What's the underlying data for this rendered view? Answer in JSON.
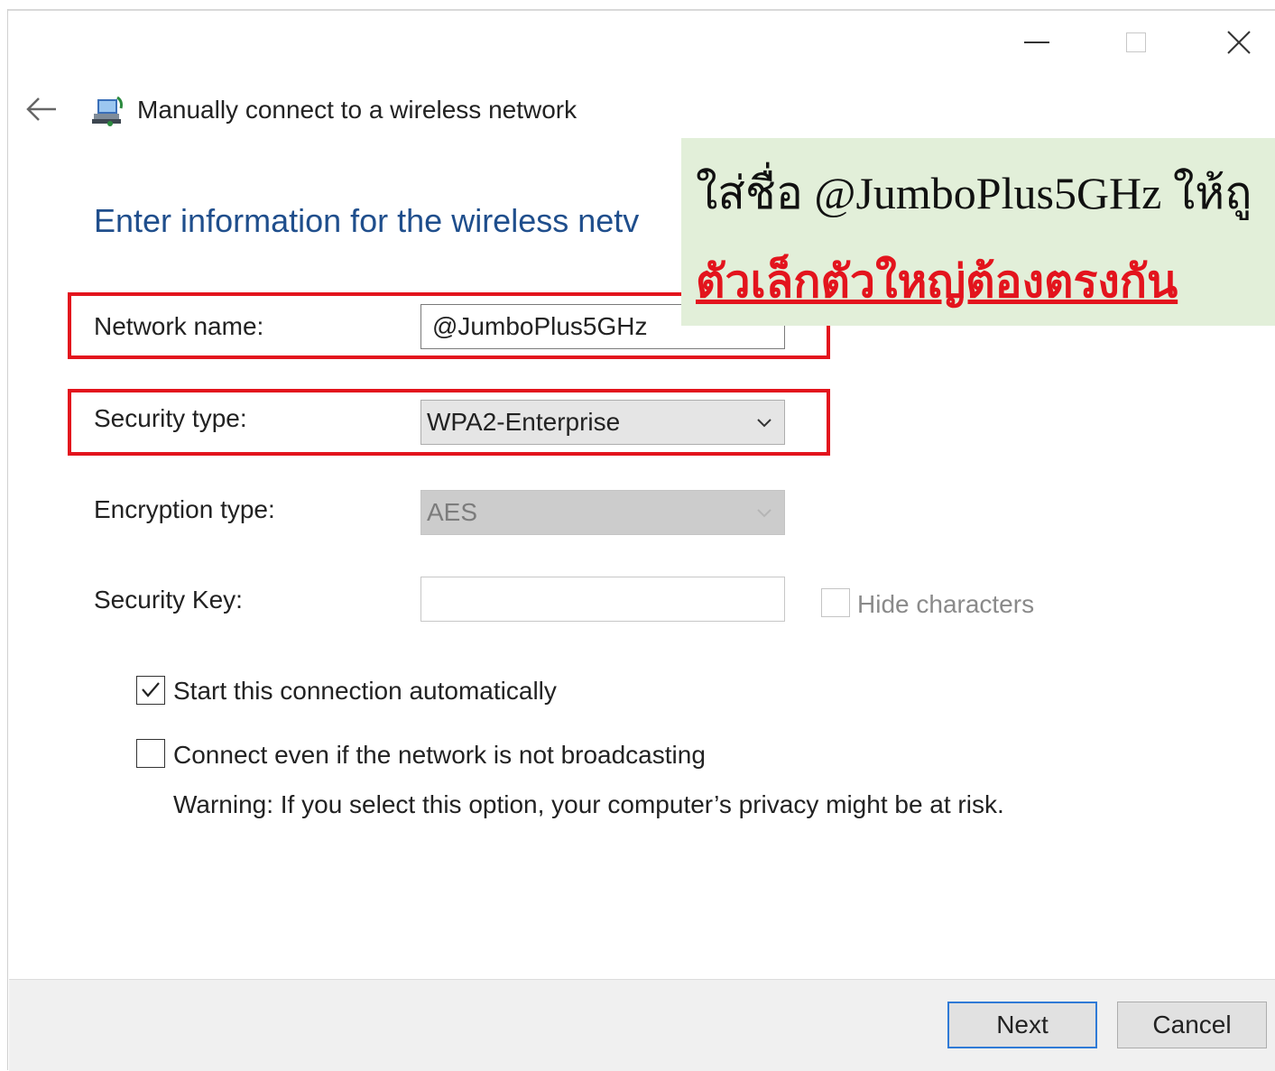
{
  "window": {
    "controls": [
      "minimize",
      "maximize",
      "close"
    ]
  },
  "header": {
    "title": "Manually connect to a wireless network",
    "back_icon": "back-arrow-icon",
    "app_icon": "network-icon"
  },
  "main": {
    "heading": "Enter information for the wireless netv",
    "fields": {
      "network_name": {
        "label": "Network name:",
        "value": "@JumboPlus5GHz"
      },
      "security_type": {
        "label": "Security type:",
        "value": "WPA2-Enterprise"
      },
      "encryption_type": {
        "label": "Encryption type:",
        "value": "AES",
        "disabled": true
      },
      "security_key": {
        "label": "Security Key:",
        "value": ""
      }
    },
    "hide_characters": {
      "label": "Hide characters",
      "checked": false,
      "disabled": true
    },
    "auto_start": {
      "label": "Start this connection automatically",
      "checked": true
    },
    "broadcast": {
      "label": "Connect even if the network is not broadcasting",
      "checked": false
    },
    "warning": "Warning: If you select this option, your computer’s privacy might be at risk."
  },
  "footer": {
    "next_label": "Next",
    "cancel_label": "Cancel"
  },
  "annotation": {
    "line1": "ใส่ชื่อ @JumboPlus5GHz ให้ถู",
    "line2": "ตัวเล็กตัวใหญ่ต้องตรงกัน",
    "highlight_color": "#e3141d",
    "background_color": "#e2efd9"
  },
  "colors": {
    "accent": "#1f4e8c",
    "button_focus": "#2f7ad6"
  }
}
